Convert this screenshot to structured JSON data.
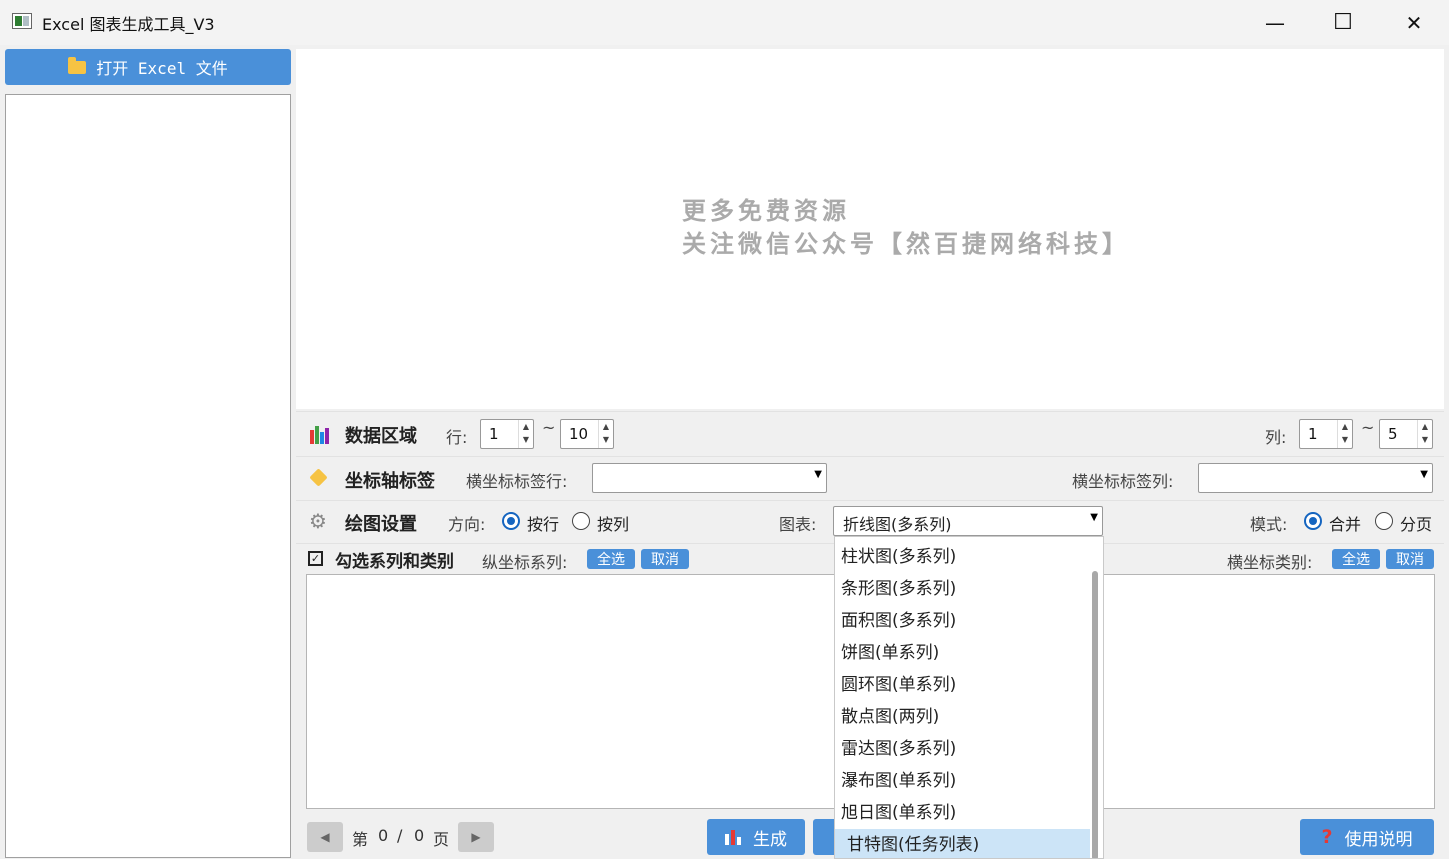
{
  "window": {
    "title": "Excel 图表生成工具_V3",
    "controls": {
      "minimize": "—",
      "maximize": "☐",
      "close": "✕"
    }
  },
  "sidebar": {
    "open_button_label": "打开 Excel 文件"
  },
  "preview": {
    "watermark_line1": "更多免费资源",
    "watermark_line2": "关注微信公众号【然百捷网络科技】"
  },
  "data_range": {
    "section_label": "数据区域",
    "row_label": "行:",
    "row_from": "1",
    "row_to": "10",
    "tilde": "~",
    "col_label": "列:",
    "col_from": "1",
    "col_to": "5"
  },
  "axis_labels": {
    "section_label": "坐标轴标签",
    "x_label_row_label": "横坐标标签行:",
    "x_label_row_value": "",
    "x_label_col_label": "横坐标标签列:",
    "x_label_col_value": ""
  },
  "plot_settings": {
    "section_label": "绘图设置",
    "direction_label": "方向:",
    "direction_options": [
      "按行",
      "按列"
    ],
    "direction_selected": "按行",
    "chart_label": "图表:",
    "chart_value": "折线图(多系列)",
    "mode_label": "模式:",
    "mode_options": [
      "合并",
      "分页"
    ],
    "mode_selected": "合并"
  },
  "series_select": {
    "section_label": "勾选系列和类别",
    "y_series_label": "纵坐标系列:",
    "select_all": "全选",
    "cancel": "取消",
    "x_category_label": "横坐标类别:"
  },
  "chart_dropdown": {
    "options": [
      "柱状图(多系列)",
      "条形图(多系列)",
      "面积图(多系列)",
      "饼图(单系列)",
      "圆环图(单系列)",
      "散点图(两列)",
      "雷达图(多系列)",
      "瀑布图(单系列)",
      "旭日图(单系列)",
      "甘特图(任务列表)"
    ],
    "highlighted": "甘特图(任务列表)"
  },
  "footer": {
    "page_prefix": "第",
    "page_current": "0",
    "page_sep": "/",
    "page_total": "0",
    "page_suffix": "页",
    "generate_label": "生成",
    "help_label": "使用说明"
  },
  "colors": {
    "accent": "#4a90d9",
    "highlight": "#cce4f7",
    "radio": "#1565c0"
  }
}
